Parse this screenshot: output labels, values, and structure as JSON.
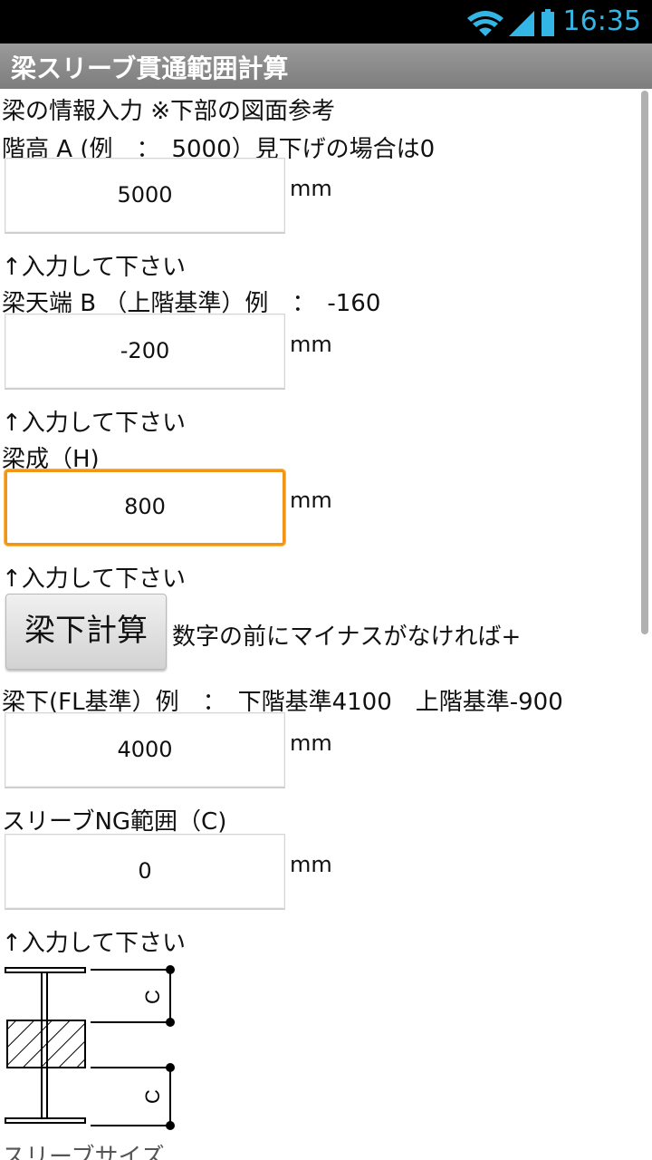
{
  "status_bar": {
    "time": "16:35",
    "icons": [
      "wifi-icon",
      "signal-icon",
      "battery-icon"
    ],
    "accent_color": "#33b5e5"
  },
  "app_title": "梁スリーブ貫通範囲計算",
  "header_instruction": "梁の情報入力 ※下部の図面参考",
  "floor_height": {
    "label": "階高 A (例　：　5000）見下げの場合は0",
    "value": "5000",
    "unit": "mm",
    "hint": "↑入力して下さい"
  },
  "beam_top": {
    "label": "梁天端 B （上階基準）例　：　-160",
    "value": "-200",
    "unit": "mm",
    "hint": "↑入力して下さい"
  },
  "beam_depth": {
    "label": "梁成（H)",
    "value": "800",
    "unit": "mm",
    "hint": "↑入力して下さい",
    "focused_color": "#f29515"
  },
  "calc_button_label": "梁下計算",
  "calc_note": "数字の前にマイナスがなければ+",
  "beam_bottom": {
    "label": "梁下(FL基準）例　：　下階基準4100　上階基準-900",
    "value": "4000",
    "unit": "mm"
  },
  "sleeve_ng": {
    "label": "スリーブNG範囲（C)",
    "value": "0",
    "unit": "mm",
    "hint": "↑入力して下さい"
  },
  "diagram": {
    "dimension_label_top": "C",
    "dimension_label_bottom": "C"
  },
  "next_label_partial": "スリーブサイズ"
}
